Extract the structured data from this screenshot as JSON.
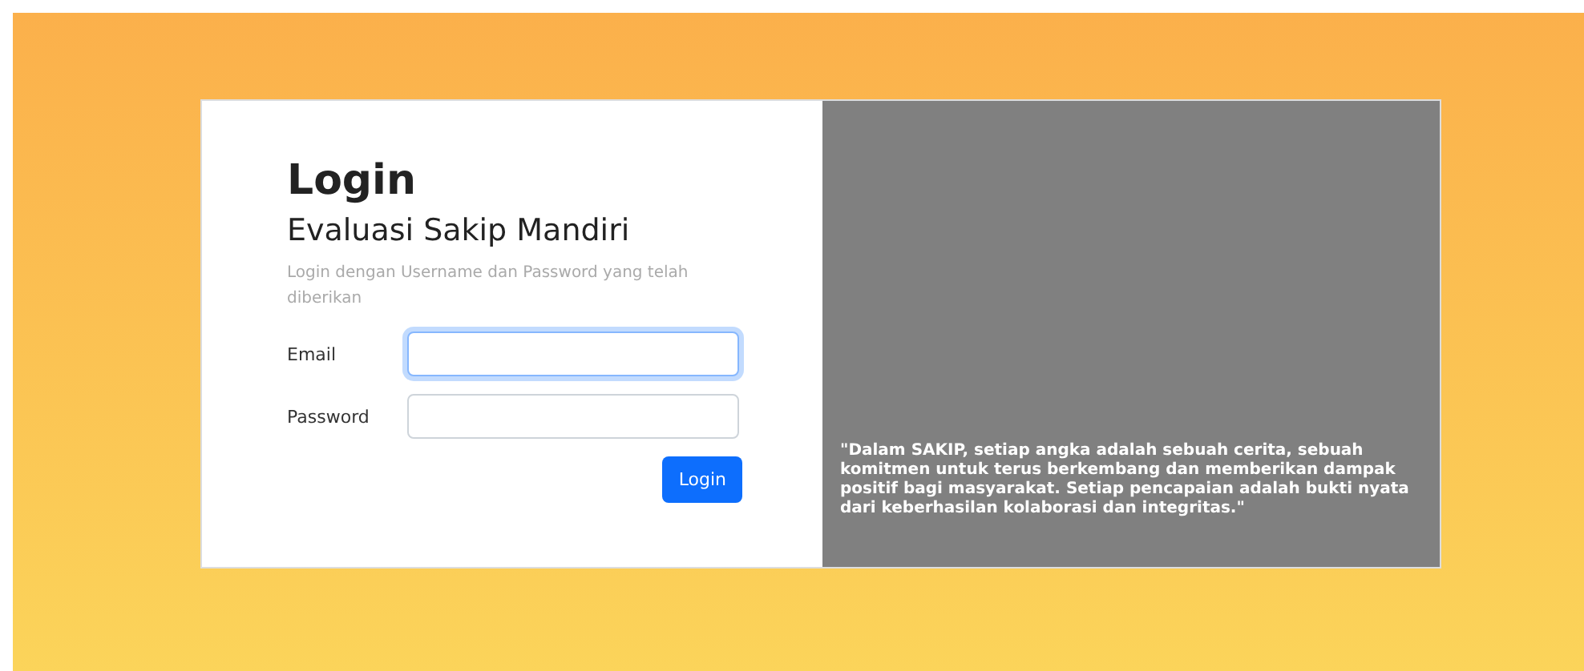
{
  "login": {
    "title": "Login",
    "subtitle": "Evaluasi Sakip Mandiri",
    "hint": "Login dengan Username dan Password yang telah diberikan",
    "fields": [
      {
        "label": "Email",
        "focused": true
      },
      {
        "label": "Password",
        "focused": false
      }
    ],
    "button": "Login"
  },
  "quote": "\"Dalam SAKIP, setiap angka adalah sebuah cerita, sebuah komitmen untuk terus berkembang dan memberikan dampak positif bagi masyarakat. Setiap pencapaian adalah bukti nyata dari keberhasilan kolaborasi dan integritas.\""
}
